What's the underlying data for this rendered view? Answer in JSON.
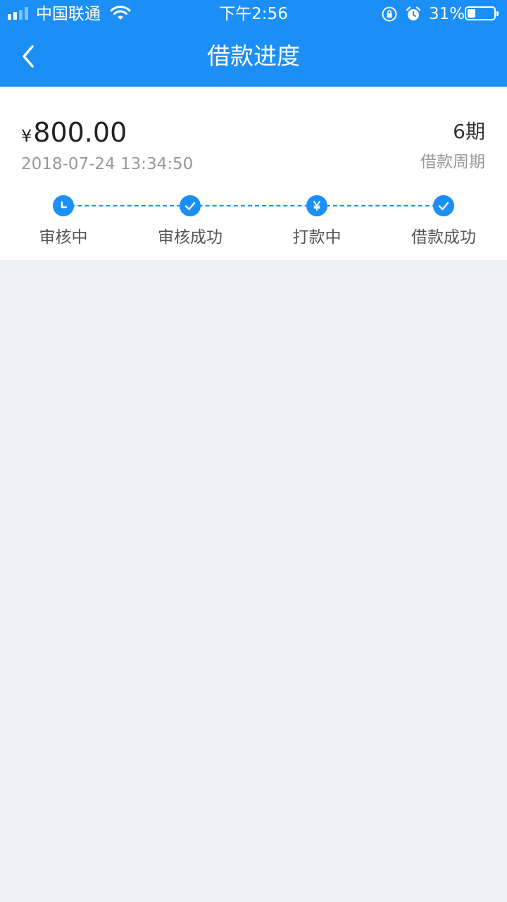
{
  "status_bar": {
    "carrier": "中国联通",
    "time": "下午2:56",
    "battery_percent_text": "31%",
    "battery_level": 0.31,
    "icons": [
      "signal-icon",
      "wifi-icon",
      "rotation-lock-icon",
      "alarm-icon",
      "battery-icon"
    ]
  },
  "nav": {
    "title": "借款进度",
    "back_icon": "chevron-left-icon"
  },
  "loan": {
    "currency_symbol": "¥",
    "amount": "800.00",
    "date": "2018-07-24 13:34:50",
    "period": "6期",
    "period_label": "借款周期"
  },
  "steps": [
    {
      "label": "审核中",
      "icon": "clock-icon"
    },
    {
      "label": "审核成功",
      "icon": "check-icon"
    },
    {
      "label": "打款中",
      "icon": "yen-icon"
    },
    {
      "label": "借款成功",
      "icon": "check-icon"
    }
  ],
  "colors": {
    "accent": "#1b8ff5",
    "page_background": "#eef0f4",
    "card_background": "#ffffff",
    "secondary_text": "#999999"
  }
}
